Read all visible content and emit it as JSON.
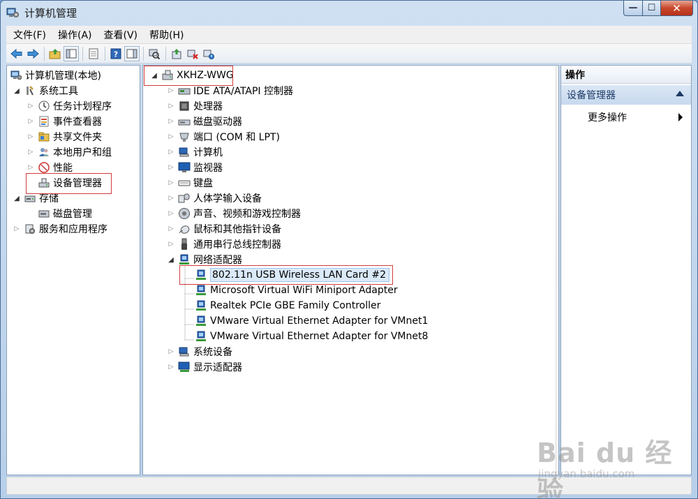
{
  "window": {
    "title": "计算机管理",
    "caption": {
      "minimize": "—",
      "maximize": "☐",
      "close": "✕"
    }
  },
  "menubar": [
    {
      "label": "文件(F)"
    },
    {
      "label": "操作(A)"
    },
    {
      "label": "查看(V)"
    },
    {
      "label": "帮助(H)"
    }
  ],
  "toolbar": {
    "icons": [
      "back-arrow-icon",
      "forward-arrow-icon",
      "up-folder-icon",
      "show-hide-tree-icon",
      "properties-icon",
      "help-icon",
      "show-hide-action-pane-icon",
      "scan-hardware-icon",
      "update-driver-icon",
      "uninstall-icon",
      "disable-device-icon"
    ]
  },
  "left_tree": {
    "root": "计算机管理(本地)",
    "system_tools": "系统工具",
    "task_scheduler": "任务计划程序",
    "event_viewer": "事件查看器",
    "shared_folders": "共享文件夹",
    "local_users": "本地用户和组",
    "performance": "性能",
    "device_manager": "设备管理器",
    "storage": "存储",
    "disk_management": "磁盘管理",
    "services_apps": "服务和应用程序"
  },
  "device_tree": {
    "computer": "XKHZ-WWG",
    "categories": [
      {
        "label": "IDE ATA/ATAPI 控制器",
        "icon": "ide-controller-icon"
      },
      {
        "label": "处理器",
        "icon": "processor-icon"
      },
      {
        "label": "磁盘驱动器",
        "icon": "disk-drive-icon"
      },
      {
        "label": "端口 (COM 和 LPT)",
        "icon": "port-icon"
      },
      {
        "label": "计算机",
        "icon": "computer-icon"
      },
      {
        "label": "监视器",
        "icon": "monitor-icon"
      },
      {
        "label": "键盘",
        "icon": "keyboard-icon"
      },
      {
        "label": "人体学输入设备",
        "icon": "hid-icon"
      },
      {
        "label": "声音、视频和游戏控制器",
        "icon": "sound-icon"
      },
      {
        "label": "鼠标和其他指针设备",
        "icon": "mouse-icon"
      },
      {
        "label": "通用串行总线控制器",
        "icon": "usb-icon"
      }
    ],
    "network_adapters": {
      "label": "网络适配器",
      "children": [
        {
          "label": "802.11n USB Wireless LAN Card #2"
        },
        {
          "label": "Microsoft Virtual WiFi Miniport Adapter"
        },
        {
          "label": "Realtek PCIe GBE Family Controller"
        },
        {
          "label": "VMware Virtual Ethernet Adapter for VMnet1"
        },
        {
          "label": "VMware Virtual Ethernet Adapter for VMnet8"
        }
      ]
    },
    "after": [
      {
        "label": "系统设备",
        "icon": "system-devices-icon"
      },
      {
        "label": "显示适配器",
        "icon": "display-adapter-icon"
      }
    ]
  },
  "actions_pane": {
    "header": "操作",
    "section": "设备管理器",
    "more": "更多操作"
  },
  "watermark": {
    "main": "Bai du 经验",
    "sub": "jingyan.baidu.com"
  },
  "colors": {
    "highlight_box": "#d23b3b",
    "selection": "#dbeaf9",
    "frame": "#b7cfe9"
  }
}
